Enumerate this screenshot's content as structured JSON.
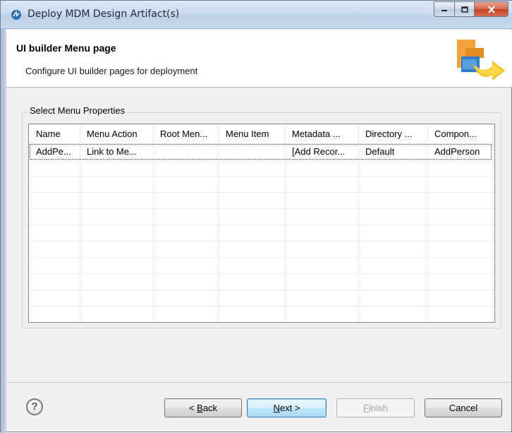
{
  "window": {
    "title": "Deploy MDM Design Artifact(s)"
  },
  "header": {
    "title": "UI builder Menu page",
    "description": "Configure UI builder pages for deployment"
  },
  "group": {
    "label": "Select Menu Properties"
  },
  "table": {
    "columns": [
      "Name",
      "Menu Action",
      "Root Men...",
      "Menu Item",
      "Metadata ...",
      "Directory ...",
      "Compon..."
    ],
    "rows": [
      [
        "AddPe...",
        "Link to Me...",
        "",
        "",
        "[Add Recor...",
        "Default",
        "AddPerson"
      ]
    ]
  },
  "buttons": {
    "back": {
      "prefix": "< ",
      "mnemonic": "B",
      "rest": "ack"
    },
    "next": {
      "mnemonic": "N",
      "rest": "ext >"
    },
    "finish": {
      "mnemonic": "F",
      "rest": "inish"
    },
    "cancel": "Cancel",
    "help": "?"
  },
  "colors": {
    "accent_default_button": "#3c7fb1",
    "close_button": "#c4401f",
    "titlebar": "#cddcee"
  }
}
